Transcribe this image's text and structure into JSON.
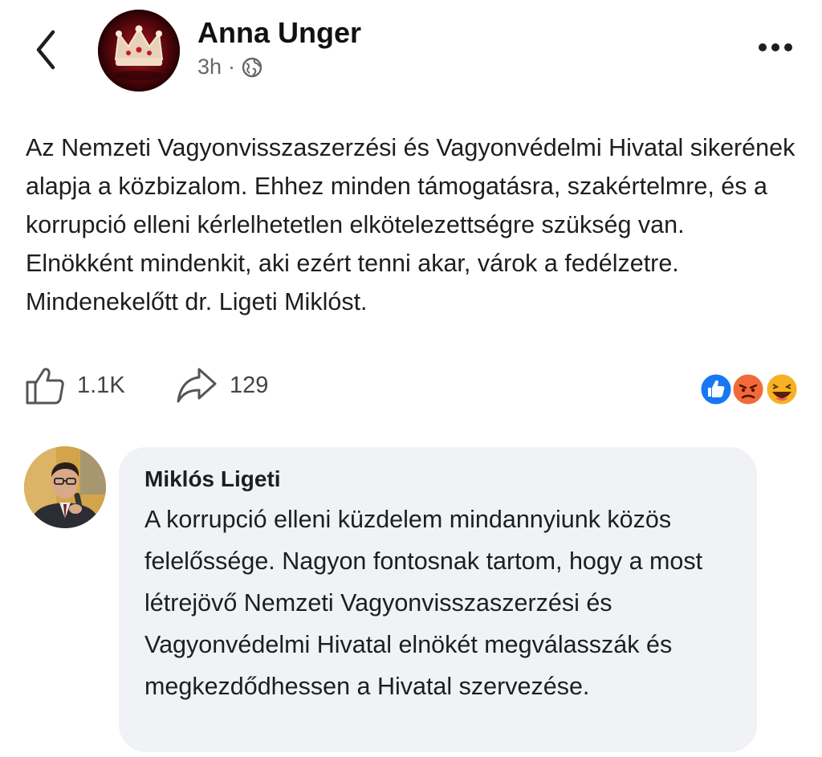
{
  "post": {
    "author": "Anna Unger",
    "time": "3h",
    "separator": "·",
    "privacy_icon": "globe-icon",
    "text": "Az Nemzeti Vagyonvisszaszerzési és Vagyonvédelmi Hivatal sikerének alapja a közbizalom. Ehhez minden támogatásra, szakértelmre, és a korrupció elleni kérlelhetetlen elkötelezettségre szükség van. Elnökként mindenkit, aki ezért tenni akar, várok a fedélzetre. Mindenekelőtt dr. Ligeti Miklóst.",
    "likes": "1.1K",
    "shares": "129",
    "reactions": [
      "like",
      "angry",
      "haha"
    ]
  },
  "comment": {
    "author": "Miklós Ligeti",
    "text": "A korrupció elleni küzdelem mindannyiunk közös felelőssége. Nagyon fontosnak tartom, hogy a most létrejövő Nemzeti Vagyonvisszaszerzési és Vagyonvédelmi Hivatal elnökét megválasszák és megkezdődhessen a Hivatal szervezése."
  },
  "colors": {
    "text": "#1c1e21",
    "meta": "#65676b",
    "bubble": "#f0f2f5",
    "like_blue": "#1877f2",
    "angry_red": "#e9710f",
    "haha_yellow": "#f7b125"
  }
}
